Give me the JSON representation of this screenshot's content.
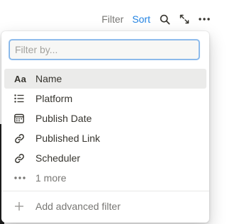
{
  "toolbar": {
    "filter_label": "Filter",
    "sort_label": "Sort",
    "accent_color": "#2383e2",
    "icons": [
      "search-icon",
      "expand-icon",
      "more-icon"
    ]
  },
  "filter_popup": {
    "search": {
      "placeholder": "Filter by...",
      "value": ""
    },
    "properties": [
      {
        "label": "Name",
        "icon": "text-type-icon",
        "selected": true
      },
      {
        "label": "Platform",
        "icon": "list-icon"
      },
      {
        "label": "Publish Date",
        "icon": "calendar-icon"
      },
      {
        "label": "Published Link",
        "icon": "link-icon"
      },
      {
        "label": "Scheduler",
        "icon": "link-icon"
      }
    ],
    "more_label": "1 more",
    "add_advanced_label": "Add advanced filter"
  }
}
